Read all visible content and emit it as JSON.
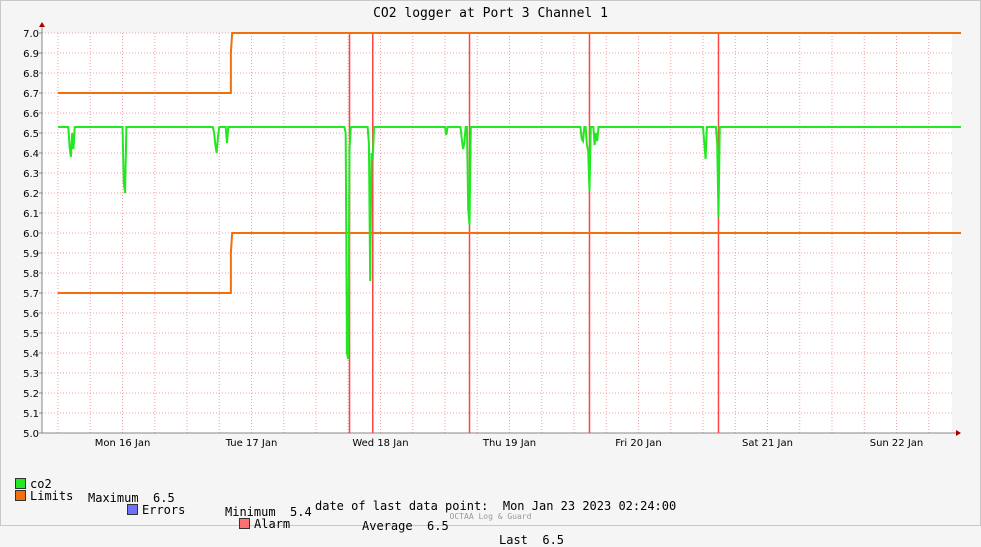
{
  "title": "CO2 logger at Port 3 Channel 1",
  "chart_data": {
    "type": "line",
    "title": "CO2 logger at Port 3 Channel 1",
    "ylim": [
      5.0,
      7.0
    ],
    "ytick_labels": [
      "5.0",
      "5.1",
      "5.2",
      "5.3",
      "5.4",
      "5.5",
      "5.6",
      "5.7",
      "5.8",
      "5.9",
      "6.0",
      "6.1",
      "6.2",
      "6.3",
      "6.4",
      "6.5",
      "6.6",
      "6.7",
      "6.8",
      "6.9",
      "7.0"
    ],
    "xlim": [
      0,
      7.0
    ],
    "xtick_labels": [
      "Mon 16 Jan",
      "Tue 17 Jan",
      "Wed 18 Jan",
      "Thu 19 Jan",
      "Fri 20 Jan",
      "Sat 21 Jan",
      "Sun 22 Jan"
    ],
    "x_unit": "days since Mon 16 Jan 00:00",
    "grid": true,
    "series": [
      {
        "name": "co2",
        "color": "#22e822",
        "baseline": 6.53,
        "x": [
          0.0,
          0.08,
          0.09,
          0.1,
          0.11,
          0.12,
          0.13,
          0.14,
          0.15,
          0.16,
          0.5,
          0.51,
          0.52,
          0.53,
          1.2,
          1.21,
          1.22,
          1.23,
          1.24,
          1.25,
          1.26,
          1.3,
          1.31,
          1.32,
          1.33,
          2.22,
          2.23,
          2.24,
          2.25,
          2.26,
          2.27,
          2.28,
          2.4,
          2.41,
          2.42,
          2.43,
          2.44,
          2.45,
          3.0,
          3.01,
          3.02,
          3.03,
          3.12,
          3.13,
          3.14,
          3.15,
          3.16,
          3.17,
          3.18,
          3.19,
          3.2,
          4.05,
          4.06,
          4.07,
          4.08,
          4.09,
          4.1,
          4.11,
          4.12,
          4.13,
          4.15,
          4.16,
          4.17,
          4.18,
          4.19,
          4.2,
          4.22,
          4.23,
          4.24,
          5.0,
          5.01,
          5.02,
          5.03,
          5.1,
          5.11,
          5.12,
          5.13,
          5.14,
          7.0
        ],
        "y": [
          6.53,
          6.53,
          6.43,
          6.38,
          6.5,
          6.42,
          6.53,
          6.53,
          6.53,
          6.53,
          6.53,
          6.25,
          6.2,
          6.53,
          6.53,
          6.5,
          6.44,
          6.4,
          6.48,
          6.53,
          6.53,
          6.53,
          6.45,
          6.53,
          6.53,
          6.53,
          6.5,
          5.4,
          5.37,
          6.42,
          6.53,
          6.53,
          6.53,
          6.45,
          5.76,
          6.4,
          6.37,
          6.53,
          6.53,
          6.49,
          6.53,
          6.53,
          6.53,
          6.47,
          6.42,
          6.45,
          6.53,
          6.53,
          6.12,
          6.04,
          6.53,
          6.53,
          6.47,
          6.46,
          6.53,
          6.53,
          6.44,
          6.41,
          6.21,
          6.53,
          6.53,
          6.44,
          6.5,
          6.46,
          6.53,
          6.53,
          6.53,
          6.53,
          6.53,
          6.53,
          6.45,
          6.37,
          6.53,
          6.53,
          6.45,
          6.08,
          6.53,
          6.53,
          6.53
        ]
      },
      {
        "name": "Limits",
        "color": "#f07010",
        "upper": {
          "x": [
            0.0,
            1.34,
            1.34,
            1.35,
            7.0
          ],
          "y": [
            6.7,
            6.7,
            6.9,
            7.0,
            7.0
          ]
        },
        "lower": {
          "x": [
            0.0,
            1.34,
            1.34,
            1.35,
            7.0
          ],
          "y": [
            5.7,
            5.7,
            5.9,
            6.0,
            6.0
          ]
        }
      }
    ],
    "alarms": {
      "name": "Alarm",
      "color": "#ff4444",
      "x": [
        2.26,
        2.44,
        3.19,
        4.12,
        5.12
      ]
    }
  },
  "legend": {
    "co2": {
      "label": "co2",
      "color": "#22e822"
    },
    "maximum": {
      "label": "Maximum",
      "value": "6.5"
    },
    "minimum": {
      "label": "Minimum",
      "value": "5.4"
    },
    "average": {
      "label": "Average",
      "value": "6.5"
    },
    "last": {
      "label": "Last",
      "value": "6.5"
    },
    "limits": {
      "label": "Limits",
      "color": "#f07010"
    },
    "errors": {
      "label": "Errors",
      "color": "#7070ff"
    },
    "alarm": {
      "label": "Alarm",
      "color": "#ff7070"
    }
  },
  "footer": {
    "last_point_label": "date of last data point:",
    "last_point_value": "Mon Jan 23 2023 02:24:00",
    "watermark": "OCTAA Log & Guard"
  }
}
